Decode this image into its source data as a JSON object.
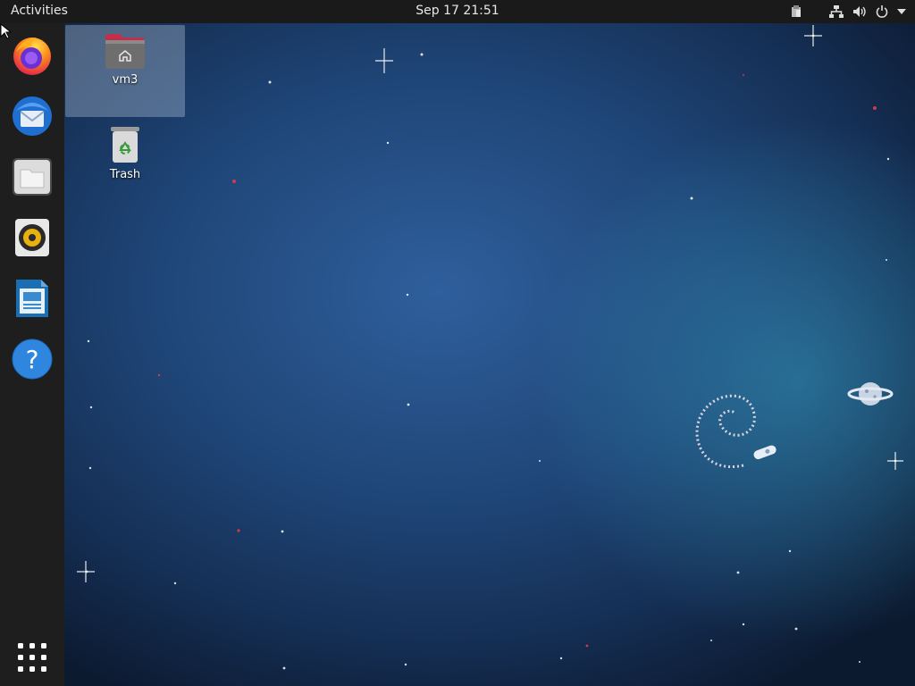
{
  "topbar": {
    "activities_label": "Activities",
    "clock": "Sep 17  21:51",
    "tray_icons": [
      "clipboard-icon",
      "network-icon",
      "volume-icon",
      "power-icon",
      "menu-arrow-icon"
    ]
  },
  "dock": {
    "items": [
      {
        "name": "Firefox",
        "icon": "firefox-icon"
      },
      {
        "name": "Thunderbird",
        "icon": "thunderbird-icon"
      },
      {
        "name": "Files",
        "icon": "files-icon"
      },
      {
        "name": "Rhythmbox",
        "icon": "rhythmbox-icon"
      },
      {
        "name": "LibreOffice Writer",
        "icon": "writer-icon"
      },
      {
        "name": "Help",
        "icon": "help-icon"
      }
    ],
    "show_apps_icon": "app-grid-icon"
  },
  "desktop": {
    "icons": [
      {
        "label": "vm3",
        "icon": "home-folder-icon",
        "selected": true
      },
      {
        "label": "Trash",
        "icon": "trash-icon",
        "selected": false
      }
    ]
  },
  "colors": {
    "topbar": "#1a1a1a",
    "dock": "#1e1e1e",
    "wallpaper": "#1f4678"
  }
}
